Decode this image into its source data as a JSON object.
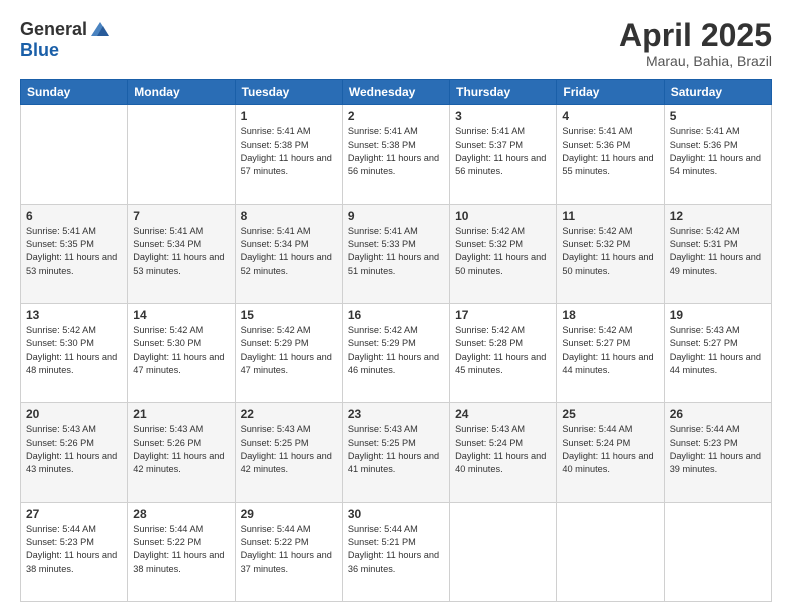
{
  "header": {
    "logo_general": "General",
    "logo_blue": "Blue",
    "month_title": "April 2025",
    "location": "Marau, Bahia, Brazil"
  },
  "weekdays": [
    "Sunday",
    "Monday",
    "Tuesday",
    "Wednesday",
    "Thursday",
    "Friday",
    "Saturday"
  ],
  "weeks": [
    [
      {
        "day": "",
        "info": ""
      },
      {
        "day": "",
        "info": ""
      },
      {
        "day": "1",
        "info": "Sunrise: 5:41 AM\nSunset: 5:38 PM\nDaylight: 11 hours and 57 minutes."
      },
      {
        "day": "2",
        "info": "Sunrise: 5:41 AM\nSunset: 5:38 PM\nDaylight: 11 hours and 56 minutes."
      },
      {
        "day": "3",
        "info": "Sunrise: 5:41 AM\nSunset: 5:37 PM\nDaylight: 11 hours and 56 minutes."
      },
      {
        "day": "4",
        "info": "Sunrise: 5:41 AM\nSunset: 5:36 PM\nDaylight: 11 hours and 55 minutes."
      },
      {
        "day": "5",
        "info": "Sunrise: 5:41 AM\nSunset: 5:36 PM\nDaylight: 11 hours and 54 minutes."
      }
    ],
    [
      {
        "day": "6",
        "info": "Sunrise: 5:41 AM\nSunset: 5:35 PM\nDaylight: 11 hours and 53 minutes."
      },
      {
        "day": "7",
        "info": "Sunrise: 5:41 AM\nSunset: 5:34 PM\nDaylight: 11 hours and 53 minutes."
      },
      {
        "day": "8",
        "info": "Sunrise: 5:41 AM\nSunset: 5:34 PM\nDaylight: 11 hours and 52 minutes."
      },
      {
        "day": "9",
        "info": "Sunrise: 5:41 AM\nSunset: 5:33 PM\nDaylight: 11 hours and 51 minutes."
      },
      {
        "day": "10",
        "info": "Sunrise: 5:42 AM\nSunset: 5:32 PM\nDaylight: 11 hours and 50 minutes."
      },
      {
        "day": "11",
        "info": "Sunrise: 5:42 AM\nSunset: 5:32 PM\nDaylight: 11 hours and 50 minutes."
      },
      {
        "day": "12",
        "info": "Sunrise: 5:42 AM\nSunset: 5:31 PM\nDaylight: 11 hours and 49 minutes."
      }
    ],
    [
      {
        "day": "13",
        "info": "Sunrise: 5:42 AM\nSunset: 5:30 PM\nDaylight: 11 hours and 48 minutes."
      },
      {
        "day": "14",
        "info": "Sunrise: 5:42 AM\nSunset: 5:30 PM\nDaylight: 11 hours and 47 minutes."
      },
      {
        "day": "15",
        "info": "Sunrise: 5:42 AM\nSunset: 5:29 PM\nDaylight: 11 hours and 47 minutes."
      },
      {
        "day": "16",
        "info": "Sunrise: 5:42 AM\nSunset: 5:29 PM\nDaylight: 11 hours and 46 minutes."
      },
      {
        "day": "17",
        "info": "Sunrise: 5:42 AM\nSunset: 5:28 PM\nDaylight: 11 hours and 45 minutes."
      },
      {
        "day": "18",
        "info": "Sunrise: 5:42 AM\nSunset: 5:27 PM\nDaylight: 11 hours and 44 minutes."
      },
      {
        "day": "19",
        "info": "Sunrise: 5:43 AM\nSunset: 5:27 PM\nDaylight: 11 hours and 44 minutes."
      }
    ],
    [
      {
        "day": "20",
        "info": "Sunrise: 5:43 AM\nSunset: 5:26 PM\nDaylight: 11 hours and 43 minutes."
      },
      {
        "day": "21",
        "info": "Sunrise: 5:43 AM\nSunset: 5:26 PM\nDaylight: 11 hours and 42 minutes."
      },
      {
        "day": "22",
        "info": "Sunrise: 5:43 AM\nSunset: 5:25 PM\nDaylight: 11 hours and 42 minutes."
      },
      {
        "day": "23",
        "info": "Sunrise: 5:43 AM\nSunset: 5:25 PM\nDaylight: 11 hours and 41 minutes."
      },
      {
        "day": "24",
        "info": "Sunrise: 5:43 AM\nSunset: 5:24 PM\nDaylight: 11 hours and 40 minutes."
      },
      {
        "day": "25",
        "info": "Sunrise: 5:44 AM\nSunset: 5:24 PM\nDaylight: 11 hours and 40 minutes."
      },
      {
        "day": "26",
        "info": "Sunrise: 5:44 AM\nSunset: 5:23 PM\nDaylight: 11 hours and 39 minutes."
      }
    ],
    [
      {
        "day": "27",
        "info": "Sunrise: 5:44 AM\nSunset: 5:23 PM\nDaylight: 11 hours and 38 minutes."
      },
      {
        "day": "28",
        "info": "Sunrise: 5:44 AM\nSunset: 5:22 PM\nDaylight: 11 hours and 38 minutes."
      },
      {
        "day": "29",
        "info": "Sunrise: 5:44 AM\nSunset: 5:22 PM\nDaylight: 11 hours and 37 minutes."
      },
      {
        "day": "30",
        "info": "Sunrise: 5:44 AM\nSunset: 5:21 PM\nDaylight: 11 hours and 36 minutes."
      },
      {
        "day": "",
        "info": ""
      },
      {
        "day": "",
        "info": ""
      },
      {
        "day": "",
        "info": ""
      }
    ]
  ]
}
